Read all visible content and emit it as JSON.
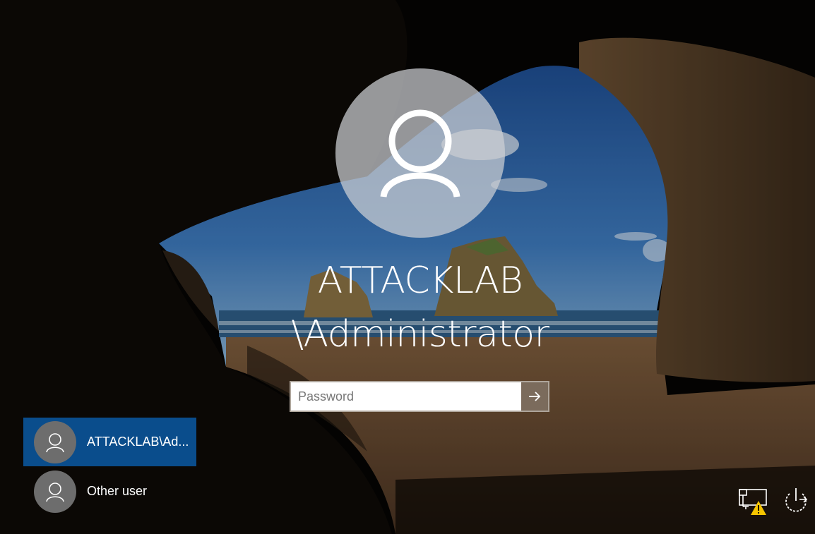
{
  "signin": {
    "username_line1": "ATTACKLAB",
    "username_line2": "\\Administrator",
    "password_placeholder": "Password"
  },
  "users": [
    {
      "label": "ATTACKLAB\\Ad...",
      "selected": true
    },
    {
      "label": "Other user",
      "selected": false
    }
  ],
  "icons": {
    "avatar": "person-icon",
    "submit": "arrow-right-icon",
    "network": "network-warning-icon",
    "power": "power-icon"
  },
  "colors": {
    "selected_tile": "#0a4d8c",
    "warning": "#f5c400"
  }
}
